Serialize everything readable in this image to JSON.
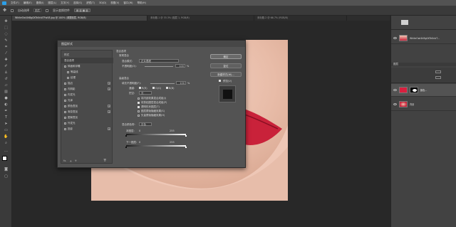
{
  "menubar": {
    "items": [
      "文件(F)",
      "编辑(E)",
      "图像(I)",
      "图层(L)",
      "文字(Y)",
      "选择(S)",
      "滤镜(T)",
      "3D(D)",
      "视图(V)",
      "窗口(W)",
      "帮助(H)"
    ]
  },
  "options": {
    "auto_select_label": "自动选择",
    "target": "图层",
    "transform_label": "显示变换控件"
  },
  "tabs": [
    "WhiteOwl4hBg0XTeXnbTFwV8.jpg @ 100% (调整图层, RGB/8)",
    "未标题-1 @ 33.3% (图层 1, RGB/8)",
    "未标题-2 @ 66.7% (RGB/8)"
  ],
  "dialog": {
    "title": "图层样式",
    "styles": [
      {
        "label": "样式",
        "checkbox": false,
        "plus": false
      },
      {
        "label": "混合选项",
        "checkbox": false,
        "plus": false,
        "selected": true
      },
      {
        "label": "斜面和浮雕",
        "checkbox": true,
        "plus": false
      },
      {
        "label": "等高线",
        "checkbox": true,
        "plus": false,
        "indent": true
      },
      {
        "label": "纹理",
        "checkbox": true,
        "plus": false,
        "indent": true
      },
      {
        "label": "描边",
        "checkbox": true,
        "plus": true
      },
      {
        "label": "内阴影",
        "checkbox": true,
        "plus": true
      },
      {
        "label": "内发光",
        "checkbox": true,
        "plus": false
      },
      {
        "label": "光泽",
        "checkbox": true,
        "plus": false
      },
      {
        "label": "颜色叠加",
        "checkbox": true,
        "plus": true
      },
      {
        "label": "渐变叠加",
        "checkbox": true,
        "plus": true
      },
      {
        "label": "图案叠加",
        "checkbox": true,
        "plus": false
      },
      {
        "label": "外发光",
        "checkbox": true,
        "plus": false
      },
      {
        "label": "投影",
        "checkbox": true,
        "plus": true
      }
    ],
    "general": {
      "section": "混合选项",
      "subsection": "常规混合",
      "blend_mode_label": "混合模式:",
      "blend_mode_value": "正片叠底",
      "opacity_label": "不透明度(O):",
      "opacity_value": "100",
      "percent": "%"
    },
    "advanced": {
      "subsection": "高级混合",
      "fill_label": "填充不透明度(F):",
      "fill_value": "100",
      "channels_label": "通道:",
      "channels": [
        "R(R)",
        "G(G)",
        "B(B)"
      ],
      "knockout_label": "挖空:",
      "knockout_value": "无",
      "options": [
        {
          "label": "将内部效果混合成组(I)",
          "checked": false
        },
        {
          "label": "将剪贴图层混合成组(P)",
          "checked": true
        },
        {
          "label": "透明形状图层(T)",
          "checked": true
        },
        {
          "label": "图层蒙版隐藏效果(S)",
          "checked": false
        },
        {
          "label": "矢量蒙版隐藏效果(H)",
          "checked": false
        }
      ]
    },
    "blend_if": {
      "label": "混合颜色带:",
      "value": "灰色",
      "this_layer_label": "本图层:",
      "this_layer_values": [
        "0",
        "255"
      ],
      "underlying_label": "下一图层:",
      "underlying_values": [
        "0",
        "255"
      ]
    },
    "buttons": {
      "ok": "确定",
      "reset": "复位",
      "new_style": "新建样式(W)...",
      "preview": "预览(V)"
    },
    "fx_label": "fx."
  },
  "layers": {
    "panel_title": "图层",
    "top_layer_name": "WhiteOwl4hBg0XTeXnbT...",
    "adjust_layer_name": "颜色...",
    "background_name": "背景"
  },
  "colors": {
    "accent": "#2b9fe8",
    "lips": "#c9223a",
    "skin": "#e9c3b1"
  }
}
